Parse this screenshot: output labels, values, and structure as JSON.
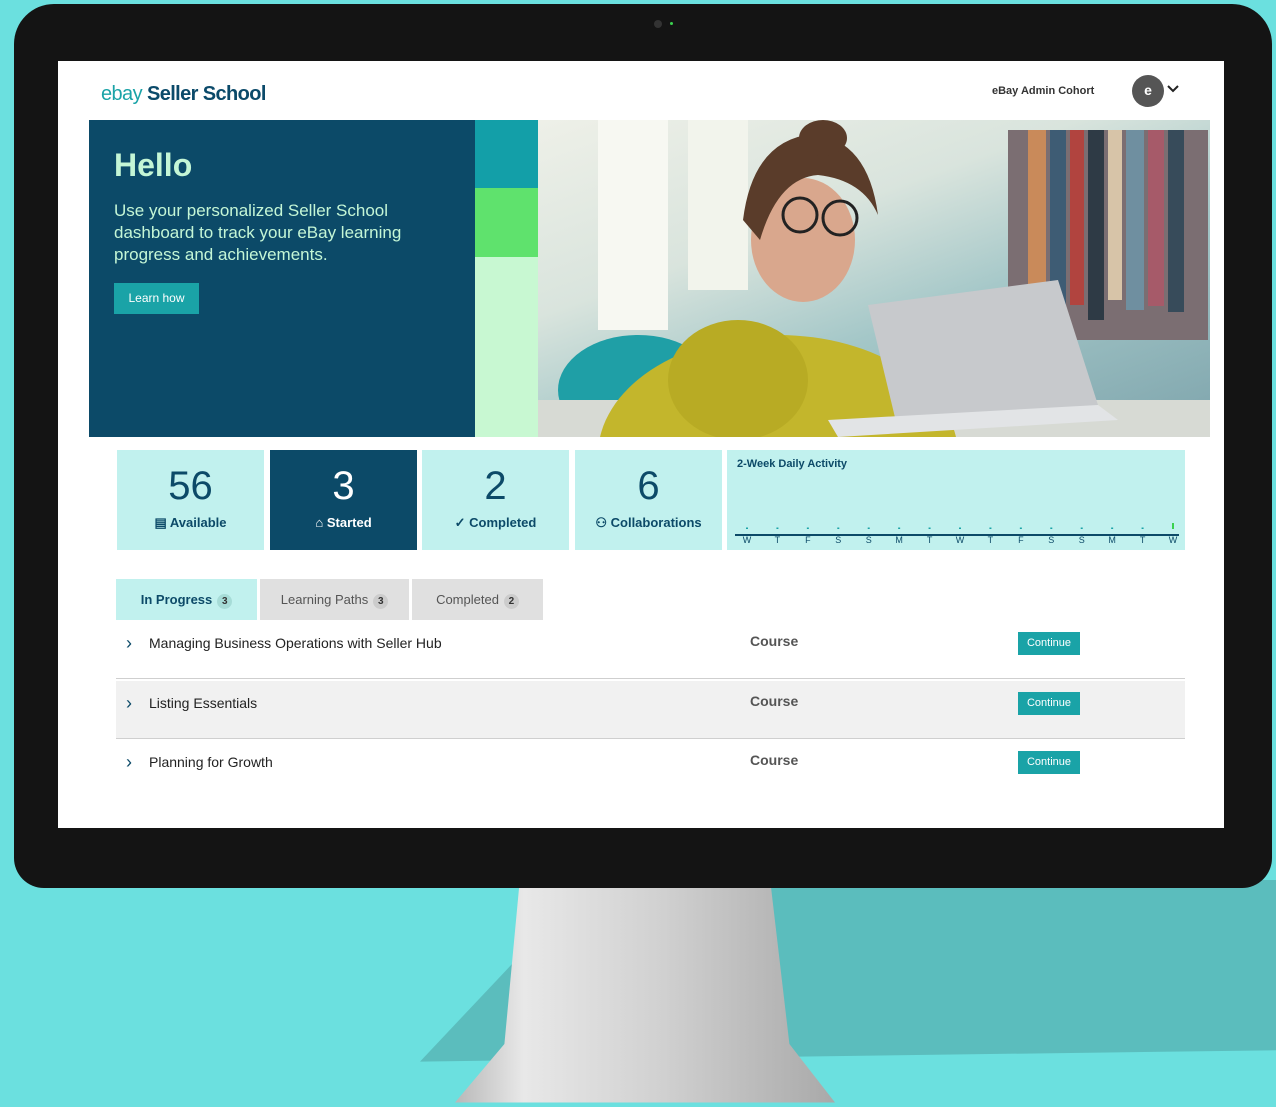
{
  "app": {
    "logo_ebay": "ebay",
    "logo_product": "Seller School"
  },
  "header": {
    "cohort": "eBay Admin Cohort",
    "avatar_initial": "e"
  },
  "hero": {
    "title": "Hello",
    "description": "Use your personalized Seller School dashboard to track your eBay learning progress and achievements.",
    "button_label": "Learn how"
  },
  "stats": [
    {
      "value": "56",
      "label": "Available",
      "icon": "book-icon"
    },
    {
      "value": "3",
      "label": "Started",
      "icon": "building-icon"
    },
    {
      "value": "2",
      "label": "Completed",
      "icon": "check-icon"
    },
    {
      "value": "6",
      "label": "Collaborations",
      "icon": "people-icon"
    }
  ],
  "activity": {
    "title": "2-Week Daily Activity",
    "days": [
      "W",
      "T",
      "F",
      "S",
      "S",
      "M",
      "T",
      "W",
      "T",
      "F",
      "S",
      "S",
      "M",
      "T",
      "W"
    ],
    "levels": [
      0,
      0,
      0,
      0,
      0,
      0,
      0,
      0,
      0,
      0,
      0,
      0,
      0,
      0,
      1
    ]
  },
  "tabs": [
    {
      "label": "In Progress",
      "count": "3"
    },
    {
      "label": "Learning Paths",
      "count": "3"
    },
    {
      "label": "Completed",
      "count": "2"
    }
  ],
  "courses": [
    {
      "title": "Managing Business Operations with Seller Hub",
      "type": "Course",
      "action": "Continue"
    },
    {
      "title": "Listing Essentials",
      "type": "Course",
      "action": "Continue"
    },
    {
      "title": "Planning for Growth",
      "type": "Course",
      "action": "Continue"
    }
  ],
  "colors": {
    "brand_dark": "#0c4a68",
    "brand_teal": "#1aa3a7",
    "mint": "#c1f1ee",
    "green": "#5fe26d"
  }
}
